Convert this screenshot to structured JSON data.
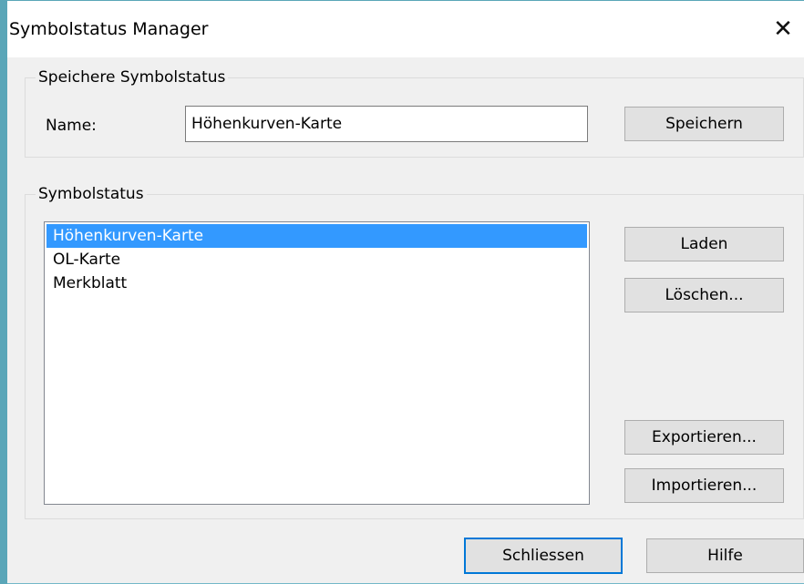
{
  "window": {
    "title": "Symbolstatus Manager",
    "close_glyph": "✕"
  },
  "save_group": {
    "label": "Speichere Symbolstatus",
    "name_label": "Name:",
    "name_value": "Höhenkurven-Karte",
    "save_button": "Speichern"
  },
  "list_group": {
    "label": "Symbolstatus",
    "items": [
      {
        "label": "Höhenkurven-Karte",
        "selected": true
      },
      {
        "label": "OL-Karte",
        "selected": false
      },
      {
        "label": "Merkblatt",
        "selected": false
      }
    ],
    "load_button": "Laden",
    "delete_button": "Löschen...",
    "export_button": "Exportieren...",
    "import_button": "Importieren..."
  },
  "footer": {
    "close_button": "Schliessen",
    "help_button": "Hilfe"
  },
  "colors": {
    "selection": "#3399ff",
    "default_button_border": "#0078d7",
    "desktop": "#73b8c8"
  }
}
